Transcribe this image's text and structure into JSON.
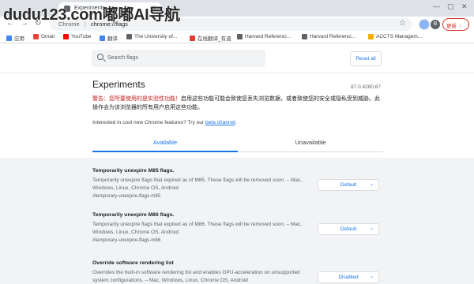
{
  "watermark": "dudu123.com嘟嘟AI导航",
  "browser": {
    "tab_title": "Experiments",
    "tab_close": "✕",
    "window_controls": {
      "minimize": "—",
      "maximize": "▢",
      "close": "✕"
    },
    "nav": {
      "back": "←",
      "forward": "→",
      "reload": "↻"
    },
    "address": {
      "scheme": "Chrome",
      "separator": "|",
      "url": "chrome://flags"
    },
    "bookmark_star": "☆",
    "avatar_letter": "B",
    "update_label": "更新 ⋮"
  },
  "bookmarks": [
    {
      "label": "应用",
      "color": "#4285f4"
    },
    {
      "label": "Gmail",
      "color": "#ea4335"
    },
    {
      "label": "YouTube",
      "color": "#ff0000"
    },
    {
      "label": "翻译",
      "color": "#4285f4"
    },
    {
      "label": "The University of...",
      "color": "#5f6368"
    },
    {
      "label": "在线翻译_有道",
      "color": "#e53935"
    },
    {
      "label": "Harvard Referenci...",
      "color": "#5f6368"
    },
    {
      "label": "Harvard Referenci...",
      "color": "#5f6368"
    },
    {
      "label": "ACCTS Managem...",
      "color": "#f9ab00"
    }
  ],
  "flags_page": {
    "search_placeholder": "Search flags",
    "reset_label": "Reset all",
    "title": "Experiments",
    "version": "87.0.4280.67",
    "warning_red": "警告：您所要使用的是实验性功能！",
    "warning_rest": "启用这些功能可能会致使您丢失浏览数据，或者致使您的安全或隐私受到威胁。此操作会为该浏览器的所有用户启用这些功能。",
    "interest_text": "Interested in cool new Chrome features? Try our",
    "interest_link": "beta channel",
    "interest_end": ".",
    "tabs": {
      "available": "Available",
      "unavailable": "Unavailable"
    },
    "flags": [
      {
        "title": "Temporarily unexpire M85 flags.",
        "description": "Temporarily unexpire flags that expired as of M85. These flags will be removed soon. – Mac, Windows, Linux, Chrome OS, Android",
        "link": "#temporary-unexpire-flags-m85",
        "value": "Default"
      },
      {
        "title": "Temporarily unexpire M86 flags.",
        "description": "Temporarily unexpire flags that expired as of M86. These flags will be removed soon. – Mac, Windows, Linux, Chrome OS, Android",
        "link": "#temporary-unexpire-flags-m86",
        "value": "Default"
      },
      {
        "title": "Override software rendering list",
        "description": "Overrides the built-in software rendering list and enables GPU-acceleration on unsupported system configurations. – Mac, Windows, Linux, Chrome OS, Android",
        "link": "",
        "value": "Disabled"
      }
    ],
    "select_caret": "⌄"
  }
}
